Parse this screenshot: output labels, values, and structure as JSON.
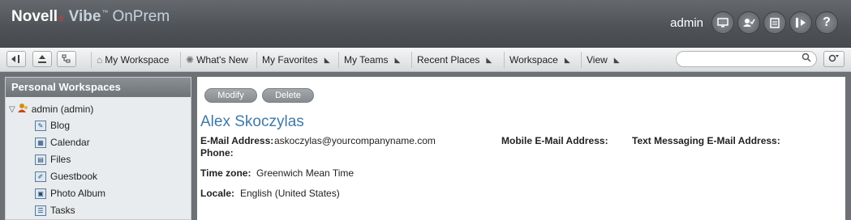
{
  "header": {
    "brand_novell": "Novell",
    "brand_dot": "®",
    "brand_vibe": "Vibe",
    "brand_tm": "™",
    "brand_onprem": "OnPrem",
    "user_name": "admin",
    "buttons": [
      "monitor-icon",
      "user-check-icon",
      "clipboard-icon",
      "exit-icon",
      "help-icon"
    ],
    "help_glyph": "?"
  },
  "toolbar": {
    "nav": [
      {
        "label": "My Workspace",
        "icon": "home-icon",
        "has_menu": false
      },
      {
        "label": "What's New",
        "icon": "sunburst-icon",
        "has_menu": false
      },
      {
        "label": "My Favorites",
        "has_menu": true
      },
      {
        "label": "My Teams",
        "has_menu": true
      },
      {
        "label": "Recent Places",
        "has_menu": true
      },
      {
        "label": "Workspace",
        "has_menu": true
      },
      {
        "label": "View",
        "has_menu": true
      }
    ],
    "search_value": "",
    "search_placeholder": ""
  },
  "sidebar": {
    "title": "Personal Workspaces",
    "root_label": "admin (admin)",
    "items": [
      {
        "label": "Blog",
        "icon": "blog-icon"
      },
      {
        "label": "Calendar",
        "icon": "calendar-icon"
      },
      {
        "label": "Files",
        "icon": "files-icon"
      },
      {
        "label": "Guestbook",
        "icon": "guestbook-icon"
      },
      {
        "label": "Photo Album",
        "icon": "photo-album-icon"
      },
      {
        "label": "Tasks",
        "icon": "tasks-icon"
      }
    ]
  },
  "profile": {
    "modify_label": "Modify",
    "delete_label": "Delete",
    "name": "Alex Skoczylas",
    "email_label": "E-Mail Address:",
    "email_value": "askoczylas@yourcompanyname.com",
    "phone_label": "Phone:",
    "mobile_email_label": "Mobile E-Mail Address:",
    "text_msg_label": "Text Messaging E-Mail Address:",
    "timezone_label": "Time zone:",
    "timezone_value": "Greenwich Mean Time",
    "locale_label": "Locale:",
    "locale_value": "English (United States)"
  },
  "colors": {
    "header_bg": "#4e5256",
    "accent_blue": "#3e7aa6",
    "button_gray": "#8a8e92"
  }
}
